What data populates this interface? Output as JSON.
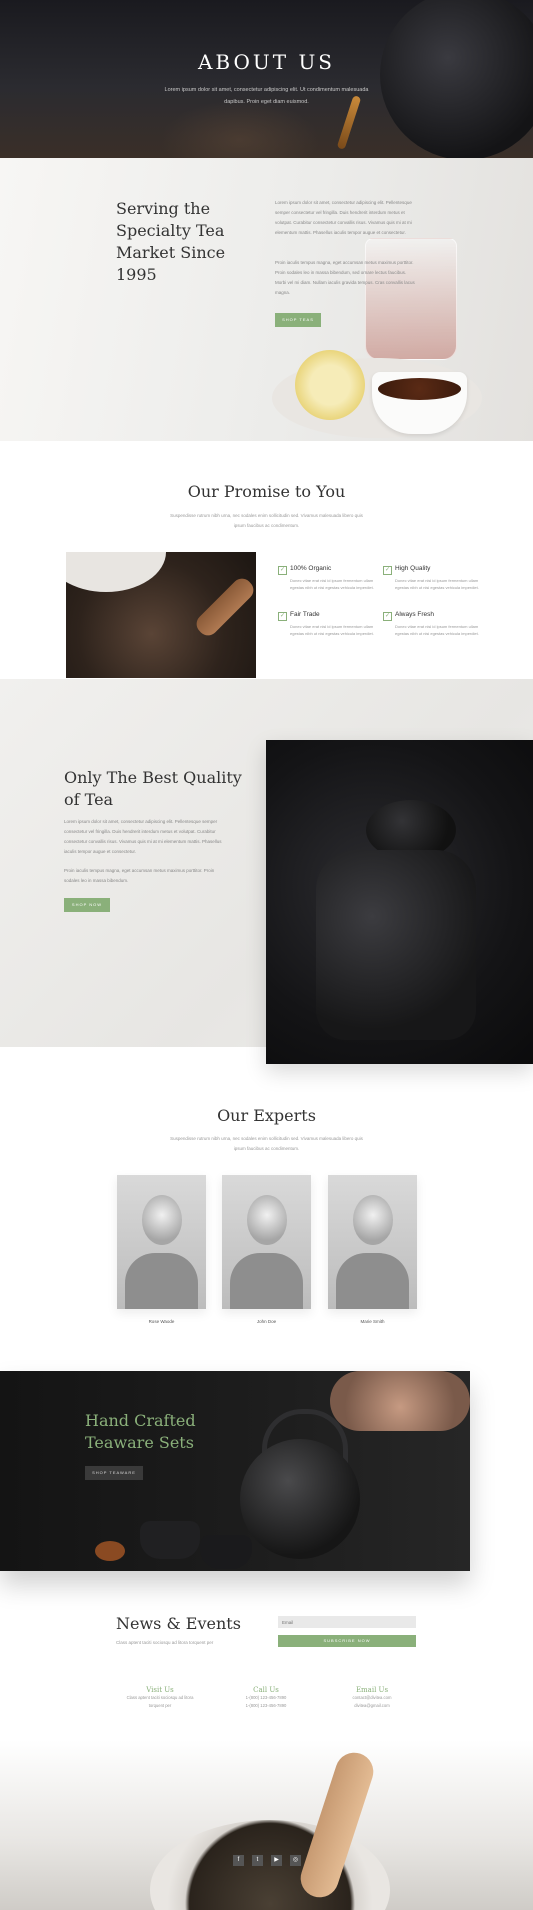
{
  "hero": {
    "title": "ABOUT US",
    "subtitle": "Lorem ipsum dolor sit amet, consectetur adipiscing elit. Ut condimentum malesuada dapibus. Proin eget diam euismod."
  },
  "intro": {
    "title": "Serving the Specialty Tea Market Since 1995",
    "paragraph1": "Lorem ipsum dolor sit amet, consectetur adipiscing elit. Pellentesque semper consectetur vel fringilla. Duis hendrerit interdum metus et volutpat. Curabitur consectetur convallis risus. Vivamus quis mi at mi elementum mattis. Phasellus iaculis tempor augue et consectetur.",
    "paragraph2": "Proin iaculis tempus magna, eget accumsan metus maximus porttitor. Proin sodales leo in massa bibendum, sed ornare lectus faucibus. Morbi vel mi diam. Nullam iaculis gravida tempus. Cras convallis lacus magna.",
    "button": "SHOP TEAS"
  },
  "promise": {
    "title": "Our Promise to You",
    "subtitle": "Suspendisse rutrum nibh urna, nec sodales enim sollicitudin sed. Vivamus malesuada libero quis ipsum faucibus ac condimentum.",
    "features": [
      {
        "title": "100% Organic",
        "desc": "Donec vitae erat nisl id ipsum fermentum ullam egestas nibh ut nisi egestas vehicula imperdiet."
      },
      {
        "title": "High Quality",
        "desc": "Donec vitae erat nisl id ipsum fermentum ullam egestas nibh ut nisi egestas vehicula imperdiet."
      },
      {
        "title": "Fair Trade",
        "desc": "Donec vitae erat nisl id ipsum fermentum ullam egestas nibh ut nisi egestas vehicula imperdiet."
      },
      {
        "title": "Always Fresh",
        "desc": "Donec vitae erat nisl id ipsum fermentum ullam egestas nibh ut nisi egestas vehicula imperdiet."
      }
    ]
  },
  "quality": {
    "title": "Only The Best Quality of Tea",
    "paragraph1": "Lorem ipsum dolor sit amet, consectetur adipiscing elit. Pellentesque semper consectetur vel fringilla. Duis hendrerit interdum metus et volutpat. Curabitur consectetur convallis risus. Vivamus quis mi at mi elementum mattis. Phasellus iaculis tempor augue et consectetur.",
    "paragraph2": "Proin iaculis tempus magna, eget accumsan metus maximus porttitor. Proin sodales leo in massa bibendum.",
    "button": "SHOP NOW"
  },
  "experts": {
    "title": "Our Experts",
    "subtitle": "Suspendisse rutrum nibh urna, nec sodales enim sollicitudin sed. Vivamus malesuada libero quis ipsum faucibus ac condimentum.",
    "people": [
      {
        "name": "Rose Waode"
      },
      {
        "name": "John Doe"
      },
      {
        "name": "Marie Smith"
      }
    ]
  },
  "teaware": {
    "title": "Hand Crafted Teaware Sets",
    "button": "SHOP TEAWARE"
  },
  "news": {
    "title": "News & Events",
    "subtitle": "Class aptent taciti sociosqu ad litora torquent per",
    "email_placeholder": "Email",
    "subscribe": "SUBSCRIBE NOW"
  },
  "contacts": [
    {
      "title": "Visit Us",
      "line1": "Class aptent taciti sociosqu ad litora",
      "line2": "torquent per"
    },
    {
      "title": "Call Us",
      "line1": "1-(800) 123-456-7890",
      "line2": "1-(800) 123-456-7890"
    },
    {
      "title": "Email Us",
      "line1": "contact@divitea.com",
      "line2": "divitea@gmail.com"
    }
  ],
  "social": {
    "facebook": "f",
    "twitter": "t",
    "youtube": "▶",
    "instagram": "◎"
  },
  "colors": {
    "accent": "#8ab07a",
    "dark": "#141414"
  }
}
